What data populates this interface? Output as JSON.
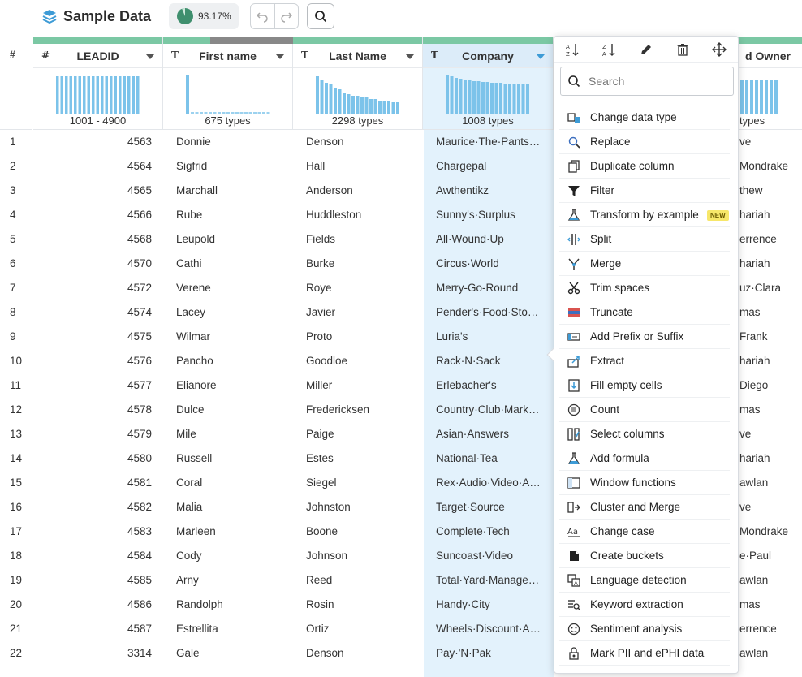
{
  "header": {
    "title": "Sample Data",
    "quality": "93.17%"
  },
  "colors": {
    "quality_good": "#7bc8a4",
    "quality_bad": "#888888",
    "selected_col": "#e3f2fc",
    "accent": "#3d9bd6",
    "new_badge": "#f7e76a"
  },
  "grid": {
    "rownum_header": "#",
    "columns": [
      {
        "type_icon": "#",
        "name": "LEADID",
        "summary": "1001 - 4900"
      },
      {
        "type_icon": "T",
        "name": "First name",
        "summary": "675 types"
      },
      {
        "type_icon": "T",
        "name": "Last Name",
        "summary": "2298 types"
      },
      {
        "type_icon": "T",
        "name": "Company",
        "summary": "1008 types"
      },
      {
        "type_icon": "T",
        "name": "d Owner",
        "summary": "types"
      }
    ],
    "rows": [
      {
        "n": "1",
        "lead": "4563",
        "first": "Donnie",
        "last": "Denson",
        "company": "Maurice·The·Pants·…",
        "owner": "ve"
      },
      {
        "n": "2",
        "lead": "4564",
        "first": "Sigfrid",
        "last": "Hall",
        "company": "Chargepal",
        "owner": "Mondrake"
      },
      {
        "n": "3",
        "lead": "4565",
        "first": "Marchall",
        "last": "Anderson",
        "company": "Awthentikz",
        "owner": "thew"
      },
      {
        "n": "4",
        "lead": "4566",
        "first": "Rube",
        "last": "Huddleston",
        "company": "Sunny's·Surplus",
        "owner": "hariah"
      },
      {
        "n": "5",
        "lead": "4568",
        "first": "Leupold",
        "last": "Fields",
        "company": "All·Wound·Up",
        "owner": "errence"
      },
      {
        "n": "6",
        "lead": "4570",
        "first": "Cathi",
        "last": "Burke",
        "company": "Circus·World",
        "owner": "hariah"
      },
      {
        "n": "7",
        "lead": "4572",
        "first": "Verene",
        "last": "Roye",
        "company": "Merry-Go-Round",
        "owner": "uz·Clara"
      },
      {
        "n": "8",
        "lead": "4574",
        "first": "Lacey",
        "last": "Javier",
        "company": "Pender's·Food·Stor…",
        "owner": "mas"
      },
      {
        "n": "9",
        "lead": "4575",
        "first": "Wilmar",
        "last": "Proto",
        "company": "Luria's",
        "owner": "Frank"
      },
      {
        "n": "10",
        "lead": "4576",
        "first": "Pancho",
        "last": "Goodloe",
        "company": "Rack·N·Sack",
        "owner": "hariah"
      },
      {
        "n": "11",
        "lead": "4577",
        "first": "Elianore",
        "last": "Miller",
        "company": "Erlebacher's",
        "owner": "Diego"
      },
      {
        "n": "12",
        "lead": "4578",
        "first": "Dulce",
        "last": "Fredericksen",
        "company": "Country·Club·Mark…",
        "owner": "mas"
      },
      {
        "n": "13",
        "lead": "4579",
        "first": "Mile",
        "last": "Paige",
        "company": "Asian·Answers",
        "owner": "ve"
      },
      {
        "n": "14",
        "lead": "4580",
        "first": "Russell",
        "last": "Estes",
        "company": "National·Tea",
        "owner": "hariah"
      },
      {
        "n": "15",
        "lead": "4581",
        "first": "Coral",
        "last": "Siegel",
        "company": "Rex·Audio·Video·A…",
        "owner": "awlan"
      },
      {
        "n": "16",
        "lead": "4582",
        "first": "Malia",
        "last": "Johnston",
        "company": "Target·Source",
        "owner": "ve"
      },
      {
        "n": "17",
        "lead": "4583",
        "first": "Marleen",
        "last": "Boone",
        "company": "Complete·Tech",
        "owner": "Mondrake"
      },
      {
        "n": "18",
        "lead": "4584",
        "first": "Cody",
        "last": "Johnson",
        "company": "Suncoast·Video",
        "owner": "e·Paul"
      },
      {
        "n": "19",
        "lead": "4585",
        "first": "Arny",
        "last": "Reed",
        "company": "Total·Yard·Manage…",
        "owner": "awlan"
      },
      {
        "n": "20",
        "lead": "4586",
        "first": "Randolph",
        "last": "Rosin",
        "company": "Handy·City",
        "owner": "mas"
      },
      {
        "n": "21",
        "lead": "4587",
        "first": "Estrellita",
        "last": "Ortiz",
        "company": "Wheels·Discount·A…",
        "owner": "errence"
      },
      {
        "n": "22",
        "lead": "3314",
        "first": "Gale",
        "last": "Denson",
        "company": "Pay·'N·Pak",
        "owner": "awlan"
      }
    ]
  },
  "menu": {
    "search_placeholder": "Search",
    "new_badge": "NEW",
    "items": [
      {
        "label": "Change data type",
        "icon": "data-type-icon"
      },
      {
        "label": "Replace",
        "icon": "replace-icon"
      },
      {
        "label": "Duplicate column",
        "icon": "duplicate-icon"
      },
      {
        "label": "Filter",
        "icon": "filter-icon"
      },
      {
        "label": "Transform by example",
        "icon": "flask-icon"
      },
      {
        "label": "Split",
        "icon": "split-icon"
      },
      {
        "label": "Merge",
        "icon": "merge-icon"
      },
      {
        "label": "Trim spaces",
        "icon": "scissors-icon"
      },
      {
        "label": "Truncate",
        "icon": "truncate-icon"
      },
      {
        "label": "Add Prefix or Suffix",
        "icon": "prefix-suffix-icon"
      },
      {
        "label": "Extract",
        "icon": "extract-icon"
      },
      {
        "label": "Fill empty cells",
        "icon": "fill-icon"
      },
      {
        "label": "Count",
        "icon": "count-icon"
      },
      {
        "label": "Select columns",
        "icon": "select-columns-icon"
      },
      {
        "label": "Add formula",
        "icon": "formula-icon"
      },
      {
        "label": "Window functions",
        "icon": "window-functions-icon"
      },
      {
        "label": "Cluster and Merge",
        "icon": "cluster-icon"
      },
      {
        "label": "Change case",
        "icon": "change-case-icon"
      },
      {
        "label": "Create buckets",
        "icon": "bucket-icon"
      },
      {
        "label": "Language detection",
        "icon": "language-icon"
      },
      {
        "label": "Keyword extraction",
        "icon": "keyword-icon"
      },
      {
        "label": "Sentiment analysis",
        "icon": "sentiment-icon"
      },
      {
        "label": "Mark PII and ePHI data",
        "icon": "lock-icon"
      }
    ]
  }
}
